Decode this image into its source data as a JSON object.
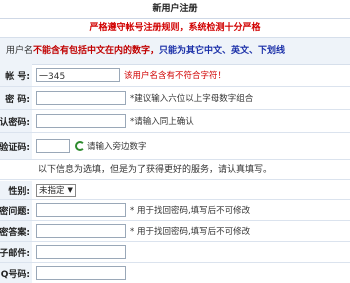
{
  "header": {
    "title": "新用户注册",
    "rules": "严格遵守帐号注册规则，系统检测十分严格"
  },
  "notice": {
    "prefix": "用户名",
    "red_text": "不能含有包括中文在内的数字，",
    "blue_text": "只能为其它中文、英文、下划线"
  },
  "form": {
    "account": {
      "label": "帐 号:",
      "value": "一345",
      "error": "该用户名含有不符合字符！"
    },
    "password": {
      "label": "密 码:",
      "hint": "*建议输入六位以上字母数字组合"
    },
    "confirm": {
      "label": "认密码:",
      "hint": "*请输入同上确认"
    },
    "captcha": {
      "label": "验证码:",
      "hint": "请输入旁边数字"
    },
    "optional_note": "以下信息为选填，但是为了获得更好的服务，请认真填写。",
    "gender": {
      "label": "性别:",
      "selected": "未指定"
    },
    "question": {
      "label": "密问题:",
      "hint": "* 用于找回密码,填写后不可修改"
    },
    "answer": {
      "label": "密答案:",
      "hint": "* 用于找回密码,填写后不可修改"
    },
    "email": {
      "label": "子邮件:"
    },
    "qq": {
      "label": "Q号码:"
    }
  }
}
